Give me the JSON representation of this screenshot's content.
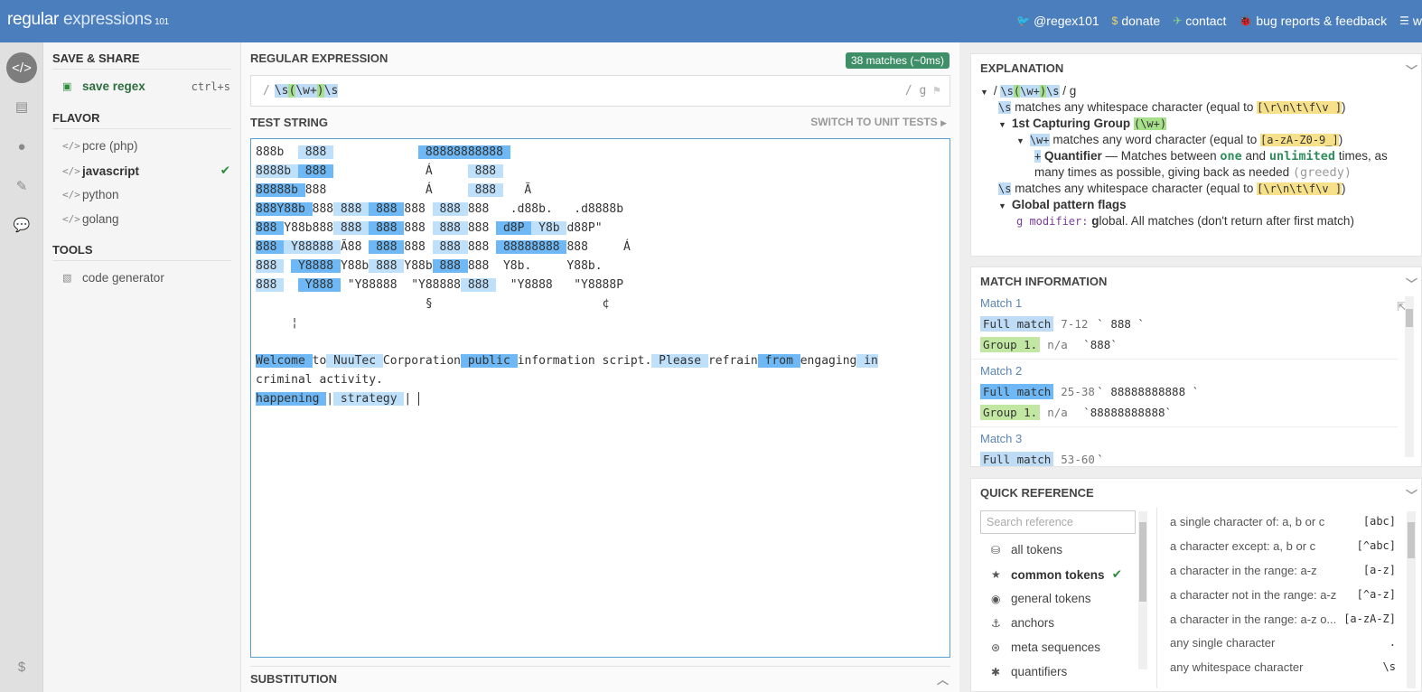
{
  "header": {
    "logo_main": "regular",
    "logo_sub": "expressions",
    "logo_ver": "101",
    "links": [
      {
        "icon": "twitter-icon",
        "glyph": "🐦",
        "label": "@regex101"
      },
      {
        "icon": "dollar-icon",
        "glyph": "$",
        "label": "donate"
      },
      {
        "icon": "paper-plane-icon",
        "glyph": "✈",
        "label": "contact"
      },
      {
        "icon": "bug-icon",
        "glyph": "🐞",
        "label": "bug reports & feedback"
      },
      {
        "icon": "wiki-icon",
        "glyph": "☰",
        "label": "w"
      }
    ]
  },
  "sidebar": {
    "save_share": "SAVE & SHARE",
    "save_regex": "save regex",
    "save_shortcut": "ctrl+s",
    "flavor": "FLAVOR",
    "flavors": [
      "pcre (php)",
      "javascript",
      "python",
      "golang"
    ],
    "tools": "TOOLS",
    "code_generator": "code generator"
  },
  "main": {
    "regex_title": "REGULAR EXPRESSION",
    "match_count": "38 matches (~0ms)",
    "delim_open": "/",
    "delim_close": "/",
    "flags": "g",
    "regex_parts": [
      "\\s",
      "(",
      "\\w+",
      ")",
      "\\s"
    ],
    "test_title": "TEST STRING",
    "switch_label": "SWITCH TO UNIT TESTS",
    "substitution": "SUBSTITUTION",
    "test_lines": [
      "888b   888              88888888888                           ",
      "8888b  888              Á      888                            ",
      "88888b 888              Á      888    Ã                       ",
      "888Y88b 888 888  888 888  888 888   .d88b.   .d8888b          ",
      "888 Y88b888 888  888 888  888 888  d8P  Y8b d88P\"             ",
      "888  Y88888 Ã88  888 888  888 888  88888888 888     Á         ",
      "888   Y8888 Y88b 888 Y88b 888 888  Y8b.     Y88b.             ",
      "888    Y888  \"Y88888  \"Y88888 888   \"Y8888   \"Y8888P          ",
      "                        §                        ¢            ",
      "     ¦                                                        ",
      "",
      "Welcome to NuuTec Corporation public information script. Please refrain from engaging in",
      "criminal activity.",
      "happening | strategy | "
    ]
  },
  "explanation": {
    "title": "EXPLANATION",
    "r1_open": "/",
    "r1_close": "/ g",
    "ws_desc": "matches any whitespace character (equal to",
    "ws_class": "[\\r\\n\\t\\f\\v ]",
    "cap_group": "1st Capturing Group",
    "cap_regex": "(\\w+)",
    "word_token": "\\w+",
    "word_desc": "matches any word character (equal to",
    "word_class": "[a-zA-Z0-9_]",
    "plus": "+",
    "quantifier": "Quantifier",
    "q_dash": "— Matches between",
    "q_one": "one",
    "q_and": "and",
    "q_unl": "unlimited",
    "q_times": "times, as",
    "q_line2": "many times as possible, giving back as needed",
    "q_greedy": "(greedy)",
    "ws_token": "\\s",
    "close_paren": ")",
    "flags_title": "Global pattern flags",
    "g_mod": "g modifier:",
    "g_letter": "g",
    "g_desc": "lobal. All matches (don't return after first match)"
  },
  "match_info": {
    "title": "MATCH INFORMATION",
    "matches": [
      {
        "title": "Match 1",
        "full": "Full match",
        "range": "7-12",
        "value": "` 888 `",
        "group": "Group 1.",
        "grange": "n/a",
        "gvalue": "`888`"
      },
      {
        "title": "Match 2",
        "full": "Full match",
        "range": "25-38",
        "value": "` 88888888888 `",
        "group": "Group 1.",
        "grange": "n/a",
        "gvalue": "`88888888888`"
      },
      {
        "title": "Match 3",
        "full": "Full match",
        "range": "53-60",
        "value": "`"
      }
    ]
  },
  "quick_ref": {
    "title": "QUICK REFERENCE",
    "search_placeholder": "Search reference",
    "categories": [
      {
        "icon": "database-icon",
        "glyph": "⛁",
        "label": "all tokens"
      },
      {
        "icon": "star-icon",
        "glyph": "★",
        "label": "common tokens"
      },
      {
        "icon": "circle-dot-icon",
        "glyph": "◉",
        "label": "general tokens"
      },
      {
        "icon": "anchor-icon",
        "glyph": "⚓",
        "label": "anchors"
      },
      {
        "icon": "lifebuoy-icon",
        "glyph": "⊛",
        "label": "meta sequences"
      },
      {
        "icon": "asterisk-icon",
        "glyph": "✱",
        "label": "quantifiers"
      }
    ],
    "items": [
      {
        "desc": "a single character of: a, b or c",
        "tok": "[abc]"
      },
      {
        "desc": "a character except: a, b or c",
        "tok": "[^abc]"
      },
      {
        "desc": "a character in the range: a-z",
        "tok": "[a-z]"
      },
      {
        "desc": "a character not in the range: a-z",
        "tok": "[^a-z]"
      },
      {
        "desc": "a character in the range: a-z o...",
        "tok": "[a-zA-Z]"
      },
      {
        "desc": "any single character",
        "tok": "."
      },
      {
        "desc": "any whitespace character",
        "tok": "\\s"
      }
    ]
  },
  "colors": {
    "topbar": "#4b7ebd",
    "match_light": "#bfe0fb",
    "match_dark": "#6db8f5",
    "badge": "#3e8e68"
  }
}
